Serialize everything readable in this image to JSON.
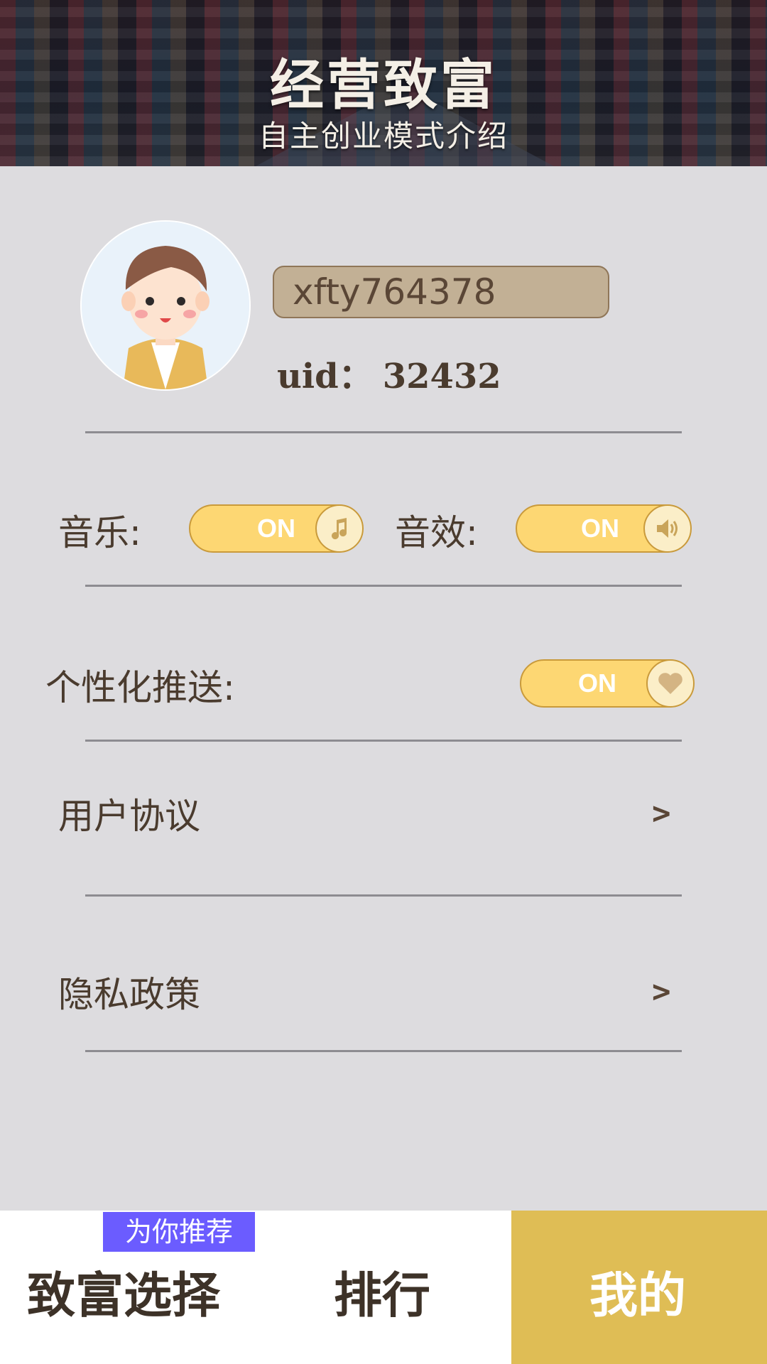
{
  "header": {
    "title": "经营致富",
    "subtitle": "自主创业模式介绍"
  },
  "profile": {
    "username": "xfty764378",
    "uid_label": "uid：",
    "uid_value": "32432"
  },
  "settings": {
    "music_label": "音乐:",
    "music_state": "ON",
    "music_icon": "music-note-icon",
    "sfx_label": "音效:",
    "sfx_state": "ON",
    "sfx_icon": "speaker-icon",
    "push_label": "个性化推送:",
    "push_state": "ON",
    "push_icon": "heart-icon"
  },
  "links": [
    {
      "label": "用户协议",
      "arrow": ">"
    },
    {
      "label": "隐私政策",
      "arrow": ">"
    }
  ],
  "bottom_nav": {
    "items": [
      {
        "label": "致富选择",
        "active": false
      },
      {
        "label": "排行",
        "active": false
      },
      {
        "label": "我的",
        "active": true
      }
    ],
    "tag": "为你推荐"
  },
  "colors": {
    "background": "#dddcdf",
    "toggle": "#fdd773",
    "active_tab": "#dfbd55",
    "tag": "#6b5cff",
    "username_box": "#c2b095"
  }
}
